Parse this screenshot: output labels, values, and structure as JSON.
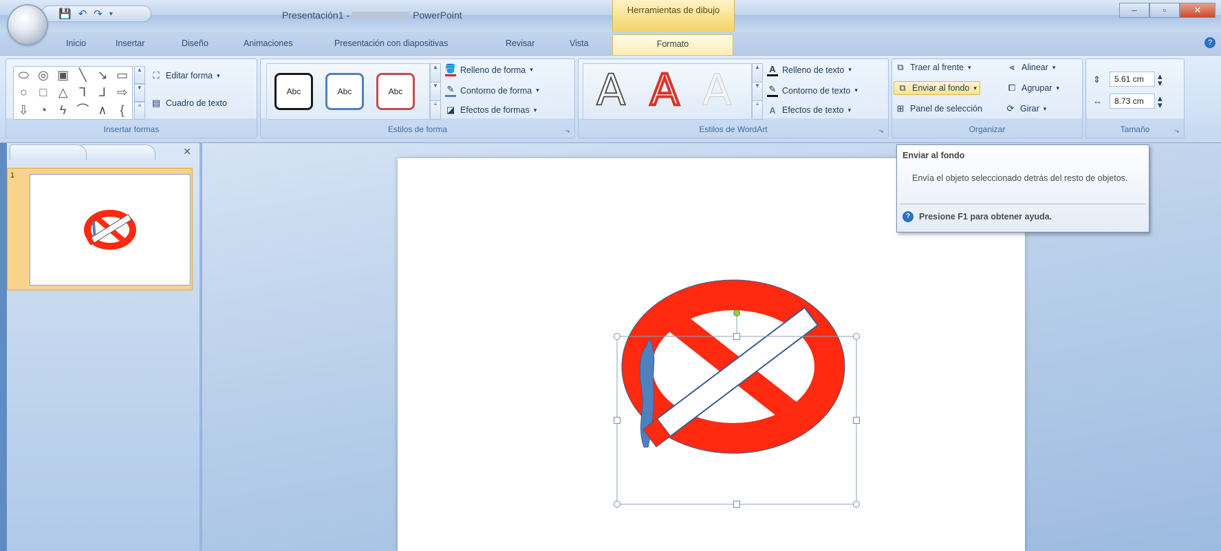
{
  "titlebar": {
    "title_left": "Presentación1 -",
    "title_right": "PowerPoint",
    "context_tab_group": "Herramientas de dibujo"
  },
  "tabs": [
    "Inicio",
    "Insertar",
    "Diseño",
    "Animaciones",
    "Presentación con diapositivas",
    "Revisar",
    "Vista",
    "Formato"
  ],
  "ribbon": {
    "insertar_formas": {
      "label": "Insertar formas",
      "editar_forma": "Editar forma",
      "cuadro_de_texto": "Cuadro de texto"
    },
    "estilos_de_forma": {
      "label": "Estilos de forma",
      "presets": [
        "Abc",
        "Abc",
        "Abc"
      ],
      "relleno": "Relleno de forma",
      "contorno": "Contorno de forma",
      "efectos": "Efectos de formas"
    },
    "estilos_wordart": {
      "label": "Estilos de WordArt",
      "relleno": "Relleno de texto",
      "contorno": "Contorno de texto",
      "efectos": "Efectos de texto"
    },
    "organizar": {
      "label": "Organizar",
      "traer_al_frente": "Traer al frente",
      "enviar_al_fondo": "Enviar al fondo",
      "panel_seleccion": "Panel de selección",
      "alinear": "Alinear",
      "agrupar": "Agrupar",
      "girar": "Girar"
    },
    "tamano": {
      "label": "Tamaño",
      "height": "5.61 cm",
      "width": "8.73 cm"
    }
  },
  "tooltip": {
    "title": "Enviar al fondo",
    "description": "Envía el objeto seleccionado detrás del resto de objetos.",
    "help": "Presione F1 para obtener ayuda."
  },
  "slides_pane": {
    "slide_number": "1"
  },
  "colors": {
    "no_smoking_red": "#ff2a10",
    "smoke_blue": "#4f81bd",
    "accent_gold": "#f7e08b"
  }
}
